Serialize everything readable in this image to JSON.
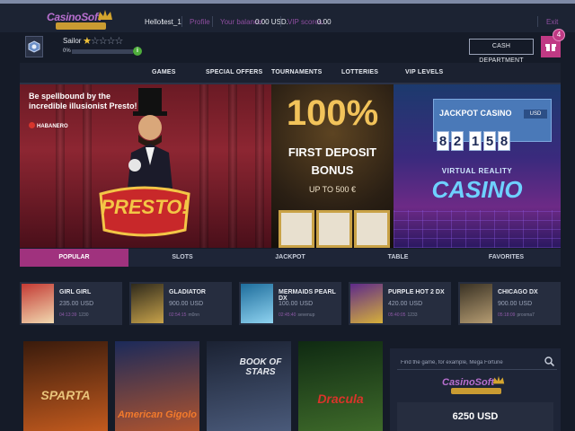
{
  "header": {
    "logo_text": "CasinoSoft",
    "greeting": "Hello!",
    "username": "test_1",
    "profile_link": "Profile",
    "balance_label": "Your balance:",
    "balance_value": "0.00 USD.",
    "vip_label": "VIP scores:",
    "vip_value": "0.00",
    "exit_link": "Exit"
  },
  "user": {
    "rank": "Sailor",
    "stars_filled": 1,
    "stars_total": 5,
    "progress_percent": 0,
    "progress_label": "0%",
    "cash_button": "CASH DEPARTMENT",
    "gift_count": "4"
  },
  "nav": [
    "GAMES",
    "SPECIAL OFFERS",
    "TOURNAMENTS",
    "LOTTERIES",
    "VIP LEVELS"
  ],
  "banners": {
    "presto": {
      "headline_1": "Be spellbound by the",
      "headline_2": "incredible illusionist Presto!",
      "provider": "HABANERO",
      "title": "PRESTO!"
    },
    "bonus": {
      "percent": "100%",
      "line1": "FIRST DEPOSIT",
      "line2": "BONUS",
      "line3": "UP TO 500 €"
    },
    "jackpot": {
      "title": "JACKPOT CASINO",
      "currency": "USD",
      "digits": [
        "8",
        "2",
        "1",
        "5",
        "8"
      ],
      "vr_top": "VIRTUAL REALITY",
      "vr_main": "CASINO"
    }
  },
  "category_tabs": [
    "POPULAR",
    "SLOTS",
    "JACKPOT",
    "TABLE",
    "FAVORITES"
  ],
  "games": [
    {
      "name": "GIRL GIRL",
      "price": "235.00 USD",
      "time": "04:13:39",
      "user": "1230",
      "colors": [
        "#c33a34",
        "#f1d9b0"
      ]
    },
    {
      "name": "GLADIATOR",
      "price": "900.00 USD",
      "time": "02:54:15",
      "user": "m0nn",
      "colors": [
        "#2f2a1c",
        "#c7a24a"
      ]
    },
    {
      "name": "MERMAIDS PEARL DX",
      "price": "100.00 USD",
      "time": "02:45:40",
      "user": "sevenup",
      "colors": [
        "#1e6d9c",
        "#8fd3f0"
      ]
    },
    {
      "name": "PURPLE HOT 2 DX",
      "price": "420.00 USD",
      "time": "05:40:05",
      "user": "1233",
      "colors": [
        "#5e2a8a",
        "#d6b03a"
      ]
    },
    {
      "name": "CHICAGO DX",
      "price": "900.00 USD",
      "time": "05:18:09",
      "user": "proxma7",
      "colors": [
        "#3a3224",
        "#b59c72"
      ]
    }
  ],
  "tiles": [
    {
      "label": "SPARTA",
      "colors": [
        "#3a1b0c",
        "#c25a1e"
      ],
      "text_color": "#e8c37a"
    },
    {
      "label": "American Gigolo",
      "colors": [
        "#1b2a5a",
        "#b0542e"
      ],
      "text_color": "#f27a2c"
    },
    {
      "label": "BOOK OF STARS",
      "colors": [
        "#1b2233",
        "#4a5a7a"
      ],
      "text_color": "#e6e9ef"
    },
    {
      "label": "Dracula",
      "colors": [
        "#0f2a12",
        "#3e6a2a"
      ],
      "text_color": "#d8342a"
    }
  ],
  "sidebar": {
    "search_placeholder": "Find the game, for example, Mega Fortune",
    "logo_text": "CasinoSoft",
    "jackpot_value": "6250 USD"
  },
  "colors": {
    "accent": "#a0327e",
    "brand_purple": "#b86fcf",
    "background": "#151b28"
  }
}
